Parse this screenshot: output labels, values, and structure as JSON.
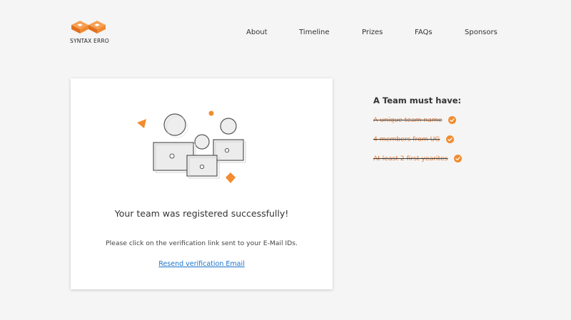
{
  "brand": {
    "name": "SYNTAX ERRO",
    "accent_color": "#f28c2f"
  },
  "nav": {
    "items": [
      {
        "label": "About"
      },
      {
        "label": "Timeline"
      },
      {
        "label": "Prizes"
      },
      {
        "label": "FAQs"
      },
      {
        "label": "Sponsors"
      }
    ]
  },
  "card": {
    "illustration_icon": "registration-success-illustration",
    "title": "Your team was registered successfully!",
    "message": "Please click on the verification link sent to your E-Mail IDs.",
    "resend_link": "Resend verification Email"
  },
  "requirements": {
    "title": "A Team must have:",
    "items": [
      {
        "label": "A unique team name",
        "done": true
      },
      {
        "label": "4 members from UG",
        "done": true
      },
      {
        "label": "At least 2 first yearites",
        "done": true
      }
    ],
    "check_icon": "check-circle-icon",
    "check_color": "#f28c2f"
  }
}
